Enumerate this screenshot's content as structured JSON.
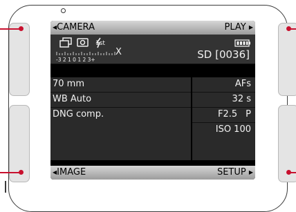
{
  "top_bar": {
    "left_label": "CAMERA",
    "right_label": "PLAY",
    "left_arrow": "◀",
    "right_arrow": "▶"
  },
  "bottom_bar": {
    "left_label": "IMAGE",
    "right_label": "SETUP",
    "left_arrow": "◀",
    "right_arrow": "▶"
  },
  "status": {
    "flash_mode": "1st",
    "exposure_scale_labels": "-3 2 1 0 1 2 3+",
    "exposure_scale_suffix": "X",
    "storage": "SD [0036]"
  },
  "info_left": [
    "70 mm",
    "WB Auto",
    "DNG comp."
  ],
  "info_right": {
    "focus": "AFs",
    "shutter": "32 s",
    "aperture": "F2.5",
    "mode": "P",
    "iso": "ISO 100"
  },
  "icons": [
    "continuous-drive-icon",
    "metering-icon",
    "flash-icon",
    "battery-icon"
  ],
  "colors": {
    "accent": "#c8102e",
    "screen": "#000000",
    "bar": "#bcbcbc"
  }
}
